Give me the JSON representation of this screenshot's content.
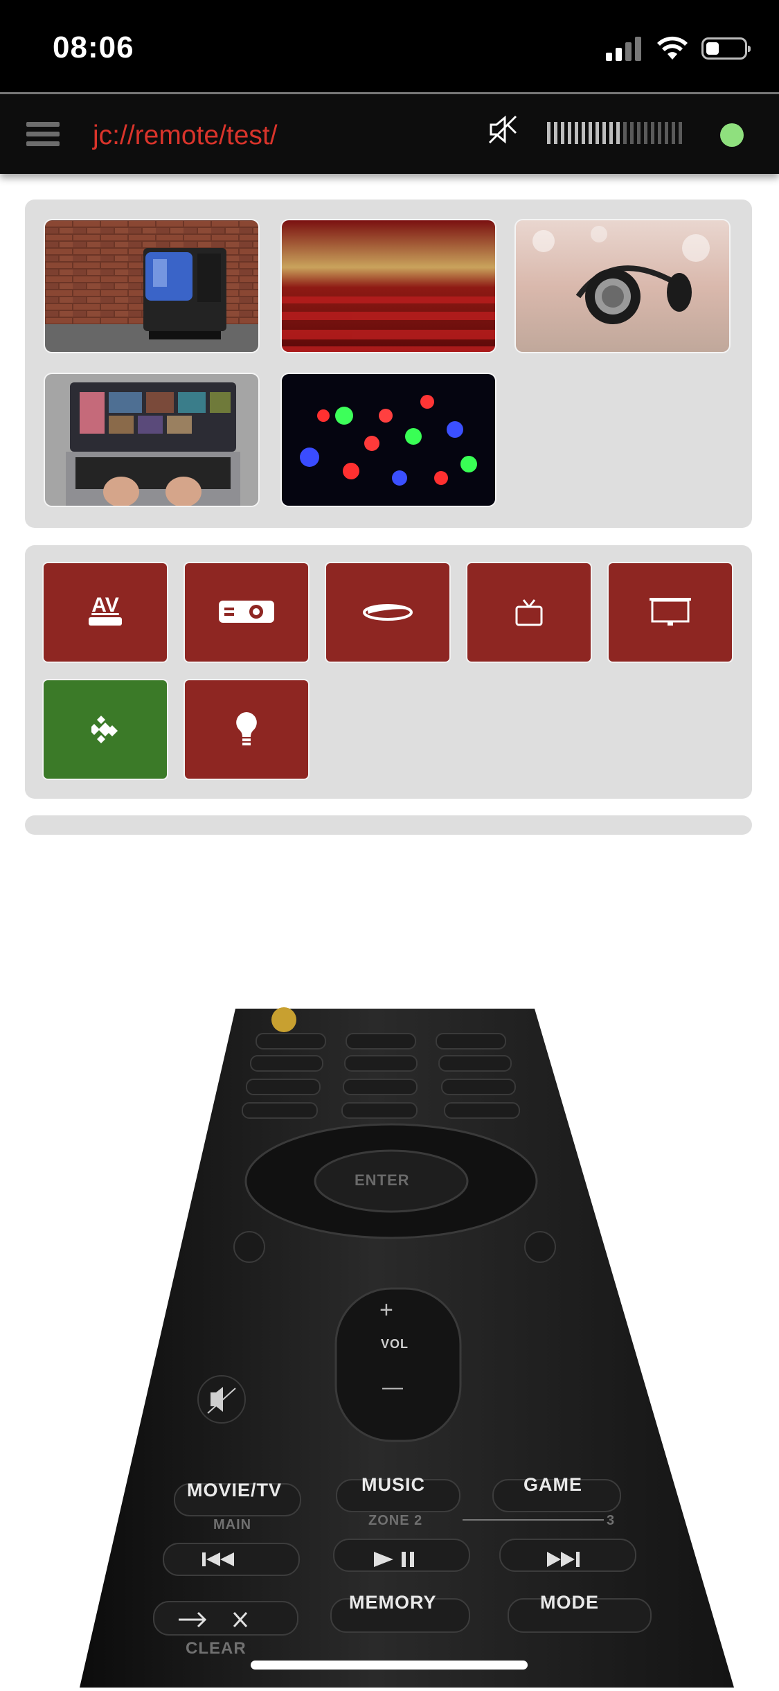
{
  "status_bar": {
    "time": "08:06",
    "icons": [
      "cellular-signal-icon",
      "wifi-icon",
      "battery-icon"
    ]
  },
  "header": {
    "title": "jc://remote/test/",
    "icons": [
      "hamburger-menu-icon",
      "mute-icon",
      "volume-level-icon",
      "connection-status-icon"
    ],
    "volume_level": 0.55,
    "connection_color": "#8fe07e"
  },
  "scenes": [
    {
      "name": "tv",
      "icon": "scene-tv-image"
    },
    {
      "name": "cinema",
      "icon": "scene-cinema-image"
    },
    {
      "name": "music",
      "icon": "scene-headphones-image"
    },
    {
      "name": "laptop",
      "icon": "scene-laptop-image"
    },
    {
      "name": "lights",
      "icon": "scene-led-lights-image"
    }
  ],
  "devices": [
    {
      "icon": "av-receiver-icon",
      "label": "AV",
      "color": "#8e2622"
    },
    {
      "icon": "projector-icon",
      "color": "#8e2622"
    },
    {
      "icon": "bluray-icon",
      "color": "#8e2622"
    },
    {
      "icon": "tv-icon",
      "color": "#8e2622"
    },
    {
      "icon": "projection-screen-icon",
      "color": "#8e2622"
    },
    {
      "icon": "kodi-icon",
      "color": "#3b7a28"
    },
    {
      "icon": "lightbulb-icon",
      "color": "#8e2622"
    }
  ],
  "remote_photo": {
    "labels": {
      "enter": "ENTER",
      "vol": "VOL",
      "vol_plus": "+",
      "vol_minus": "—",
      "movie_tv": "MOVIE/TV",
      "music": "MUSIC",
      "game": "GAME",
      "main": "MAIN",
      "zone2": "ZONE 2",
      "zone3": "3",
      "memory": "MEMORY",
      "mode": "MODE",
      "clear": "CLEAR"
    }
  }
}
